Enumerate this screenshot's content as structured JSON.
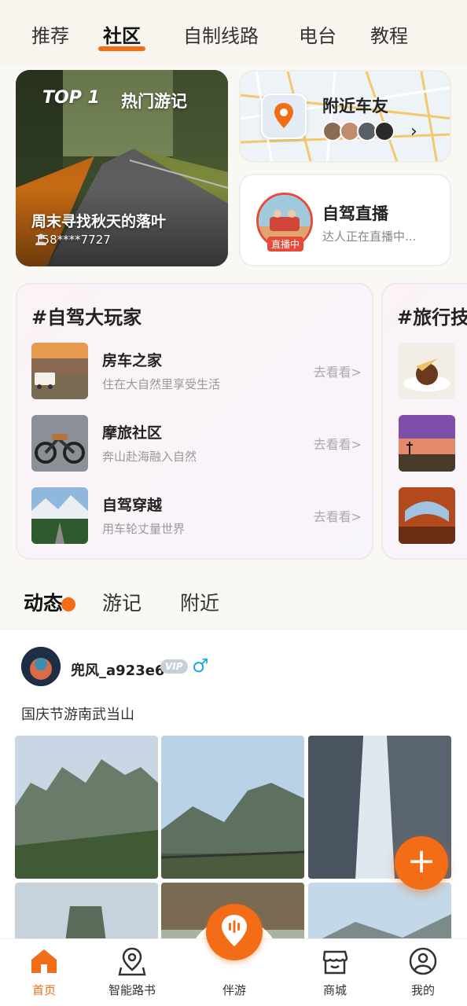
{
  "top_tabs": [
    "推荐",
    "社区",
    "自制线路",
    "电台",
    "教程"
  ],
  "hero": {
    "badge_prefix": "TOP 1",
    "badge_num": "1",
    "badge_title": "热门游记",
    "title": "周末寻找秋天的落叶",
    "user": "158****7727"
  },
  "nearby": {
    "title": "附近车友"
  },
  "live": {
    "title": "自驾直播",
    "badge": "直播中",
    "subtitle": "达人正在直播中..."
  },
  "topic_cards": [
    {
      "title": "#自驾大玩家",
      "items": [
        {
          "name": "房车之家",
          "desc": "住在大自然里享受生活",
          "action": "去看看>"
        },
        {
          "name": "摩旅社区",
          "desc": "奔山赴海融入自然",
          "action": "去看看>"
        },
        {
          "name": "自驾穿越",
          "desc": "用车轮丈量世界",
          "action": "去看看>"
        }
      ]
    },
    {
      "title": "#旅行技"
    }
  ],
  "feed_tabs": [
    "动态",
    "游记",
    "附近"
  ],
  "post": {
    "username": "兜风_a923e6",
    "vip": "VIP",
    "gender": "♂",
    "text": "国庆节游南武当山"
  },
  "fab": "+",
  "bottom_nav": [
    {
      "label": "首页",
      "icon": "home-icon"
    },
    {
      "label": "智能路书",
      "icon": "map-pin-icon"
    },
    {
      "label": "伴游",
      "icon": "voice-pin-icon"
    },
    {
      "label": "商城",
      "icon": "shop-icon"
    },
    {
      "label": "我的",
      "icon": "user-icon"
    }
  ],
  "colors": {
    "accent": "#f36d16",
    "live_red": "#e54a3b",
    "male_blue": "#29a8e0"
  }
}
